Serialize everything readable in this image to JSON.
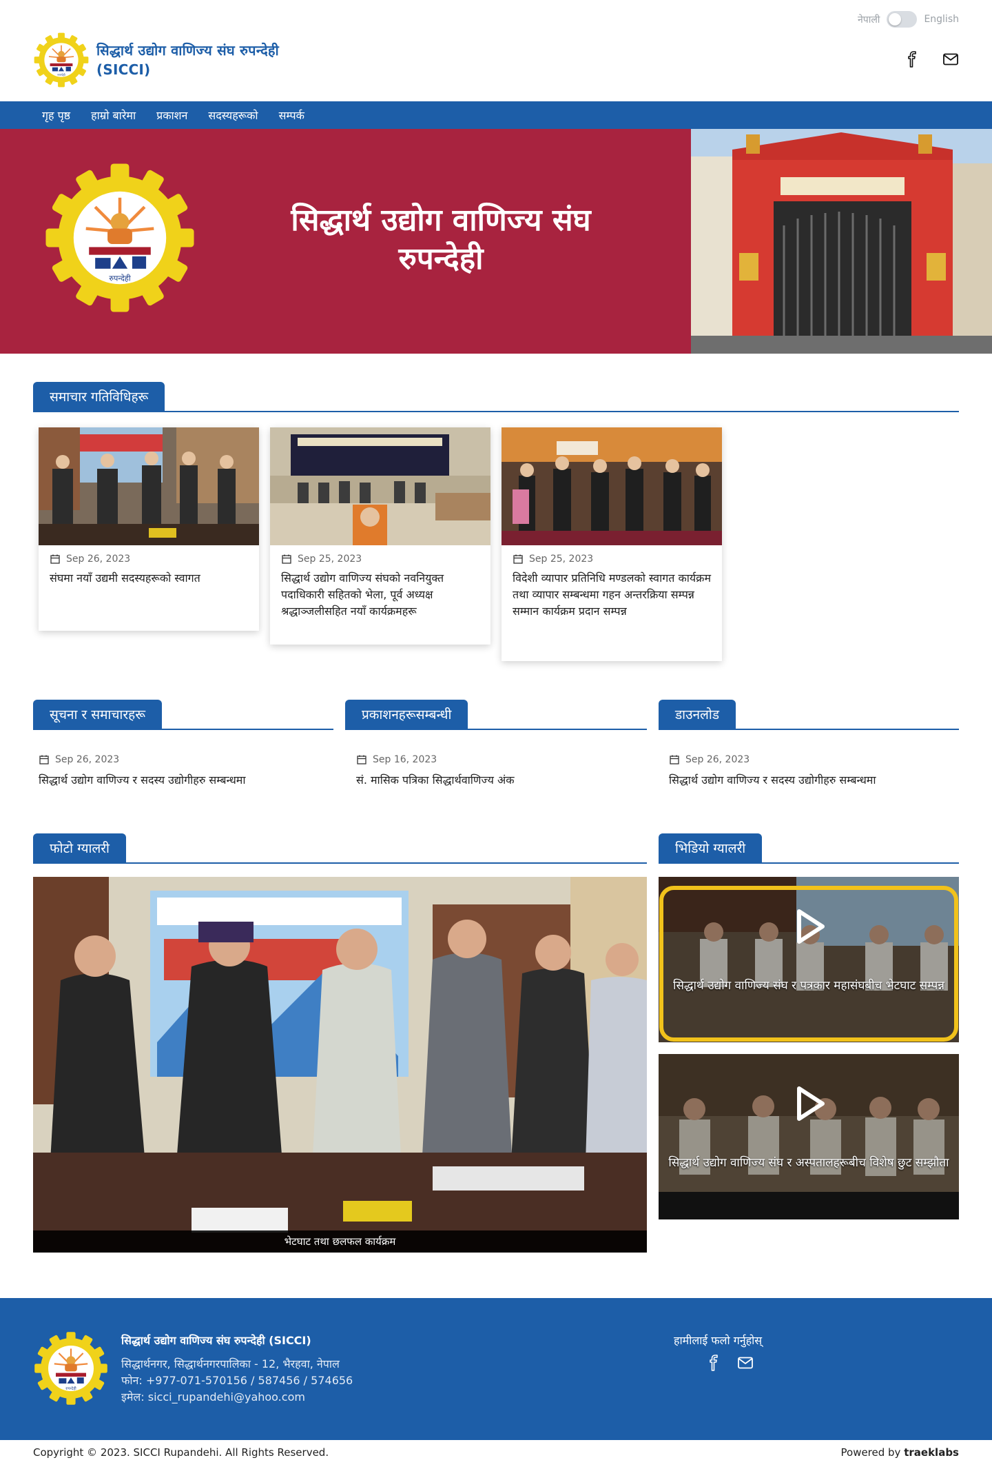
{
  "lang": {
    "left": "नेपाली",
    "right": "English"
  },
  "brand": {
    "name": "सिद्धार्थ उद्योग वाणिज्य संघ रुपन्देही",
    "abbr": "(SICCI)"
  },
  "nav": [
    "गृह पृष्ठ",
    "हाम्रो बारेमा",
    "प्रकाशन",
    "सदस्यहरूको",
    "सम्पर्क"
  ],
  "hero": {
    "title_line1": "सिद्धार्थ उद्योग वाणिज्य संघ",
    "title_line2": "रुपन्देही"
  },
  "sections": {
    "news": "समाचार गतिविधिहरू",
    "notice": "सूचना र समाचारहरू",
    "publications": "प्रकाशनहरूसम्बन्धी",
    "downloads": "डाउनलोड",
    "photo": "फोटो ग्यालरी",
    "video": "भिडियो ग्यालरी"
  },
  "news_cards": [
    {
      "date": "Sep 26, 2023",
      "title": "संघमा नयाँ उद्यमी सदस्यहरूको स्वागत"
    },
    {
      "date": "Sep 25, 2023",
      "title": "सिद्धार्थ उद्योग वाणिज्य संघको नवनियुक्त पदाधिकारी सहितको भेला, पूर्व अध्यक्ष श्रद्धाञ्जलीसहित नयाँ कार्यक्रमहरू"
    },
    {
      "date": "Sep 25, 2023",
      "title": "विदेशी व्यापार प्रतिनिधि मण्डलको स्वागत कार्यक्रम तथा व्यापार सम्बन्धमा गहन अन्तरक्रिया सम्पन्न सम्मान कार्यक्रम प्रदान सम्पन्न"
    }
  ],
  "notice": {
    "date": "Sep 26, 2023",
    "title": "सिद्धार्थ उद्योग वाणिज्य र सदस्य उद्योगीहरु सम्बन्धमा"
  },
  "publications": {
    "date": "Sep 16, 2023",
    "title": "सं. मासिक पत्रिका सिद्धार्थवाणिज्य अंक"
  },
  "downloads": {
    "date": "Sep 26, 2023",
    "title": "सिद्धार्थ उद्योग वाणिज्य र सदस्य उद्योगीहरु सम्बन्धमा"
  },
  "photo": {
    "caption": "भेटघाट तथा छलफल कार्यक्रम"
  },
  "videos": [
    {
      "title": "सिद्धार्थ उद्योग वाणिज्य संघ र पत्रकार महासंघबीच भेटघाट सम्पन्न"
    },
    {
      "title": "सिद्धार्थ उद्योग वाणिज्य संघ र अस्पतालहरूबीच विशेष छुट सम्झौता"
    }
  ],
  "footer": {
    "name": "सिद्धार्थ उद्योग वाणिज्य संघ रुपन्देही (SICCI)",
    "address": "सिद्धार्थनगर, सिद्धार्थनगरपालिका - 12, भैरहवा, नेपाल",
    "phone": "फोन: +977-071-570156 / 587456 / 574656",
    "email": "इमेल: sicci_rupandehi@yahoo.com",
    "follow": "हामीलाई फलो गर्नुहोस्"
  },
  "copyright": "Copyright © 2023. SICCI Rupandehi. All Rights Reserved.",
  "powered": {
    "prefix": "Powered by ",
    "brand": "traeklabs"
  },
  "colors": {
    "primary": "#1d5ea8",
    "hero_bg": "#a8233f",
    "logo_yellow": "#f3d81c"
  }
}
